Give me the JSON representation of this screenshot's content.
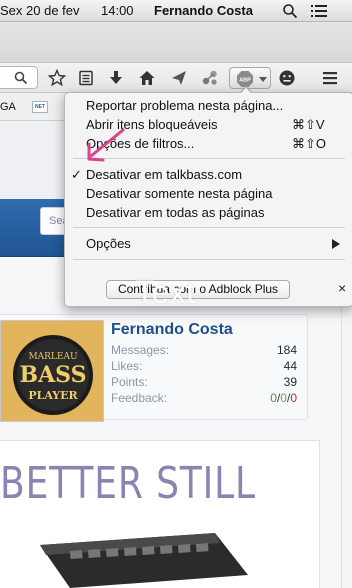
{
  "menubar": {
    "date": "Sex 20 de fev",
    "time": "14:00",
    "user": "Fernando Costa"
  },
  "bookmarks": {
    "item1": "GA",
    "item2_icon_text": "NET"
  },
  "page": {
    "search_placeholder": "Search..."
  },
  "profile": {
    "name": "Fernando Costa",
    "avatar_text_top": "MARLEAU",
    "avatar_text_main": "BASS",
    "avatar_text_bottom": "PLAYER",
    "stats": [
      {
        "label": "Messages:",
        "value": "184"
      },
      {
        "label": "Likes:",
        "value": "44"
      },
      {
        "label": "Points:",
        "value": "39"
      }
    ],
    "feedback_label": "Feedback:",
    "feedback_positive": "0",
    "feedback_neutral": "0",
    "feedback_negative": "0",
    "feedback_sep": "/"
  },
  "ad": {
    "headline": "BETTER STILL"
  },
  "abp_menu": {
    "items": [
      {
        "label": "Reportar problema nesta página...",
        "shortcut": ""
      },
      {
        "label": "Abrir itens bloqueáveis",
        "shortcut": "⌘⇧V"
      },
      {
        "label": "Opções de filtros...",
        "shortcut": "⌘⇧O"
      }
    ],
    "check_mark": "✓",
    "disable_items": [
      "Desativar em talkbass.com",
      "Desativar somente nesta página",
      "Desativar em todas as páginas"
    ],
    "options_label": "Opções",
    "contribute_label": "Contribua com o Adblock Plus",
    "close_label": "×"
  },
  "overlay_text": "Text",
  "colors": {
    "menu_bg": "#f4f4f4",
    "link_blue": "#1f4f8a",
    "band_blue": "#2f6cae",
    "arrow_pink": "#d9438f",
    "ad_text": "#8d83b3"
  }
}
